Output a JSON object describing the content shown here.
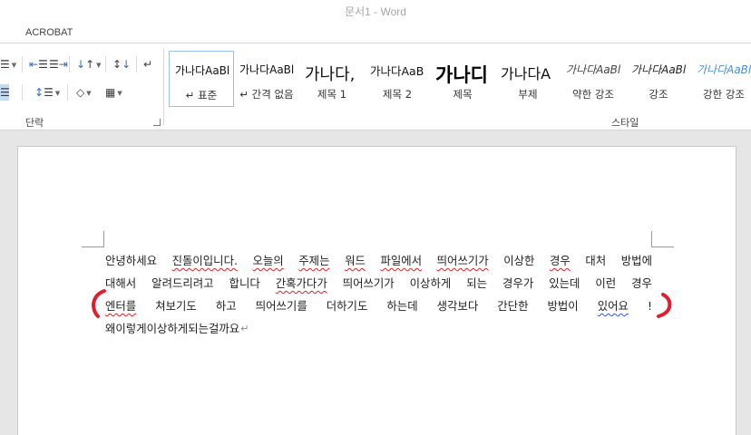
{
  "window": {
    "title": "문서1 - Word"
  },
  "ribbon": {
    "tab": "ACROBAT",
    "paragraph_group_label": "단락",
    "styles_group_label": "스타일",
    "styles": [
      {
        "sample": "가나다AaBl",
        "label": "↵ 표준",
        "size": 12,
        "weight": "normal",
        "italic": false,
        "color": "#111111"
      },
      {
        "sample": "가나다AaBl",
        "label": "↵ 간격 없음",
        "size": 12,
        "weight": "normal",
        "italic": false,
        "color": "#111111"
      },
      {
        "sample": "가나다,",
        "label": "제목 1",
        "size": 18,
        "weight": "normal",
        "italic": false,
        "color": "#111111"
      },
      {
        "sample": "가나다AaB",
        "label": "제목 2",
        "size": 12.5,
        "weight": "normal",
        "italic": false,
        "color": "#111111"
      },
      {
        "sample": "가나디",
        "label": "제목",
        "size": 21,
        "weight": "bold",
        "italic": false,
        "color": "#000000"
      },
      {
        "sample": "가나다A",
        "label": "부제",
        "size": 16,
        "weight": "normal",
        "italic": false,
        "color": "#111111"
      },
      {
        "sample": "가나다AaBl",
        "label": "약한 강조",
        "size": 12,
        "weight": "normal",
        "italic": true,
        "color": "#444444"
      },
      {
        "sample": "가나다AaBl",
        "label": "강조",
        "size": 12,
        "weight": "normal",
        "italic": true,
        "color": "#222222"
      },
      {
        "sample": "가나다AaBl",
        "label": "강한 강조",
        "size": 12,
        "weight": "normal",
        "italic": true,
        "color": "#4a8fd1"
      }
    ]
  },
  "document": {
    "lines": [
      [
        {
          "text": "안녕하세요",
          "sq": ""
        },
        {
          "text": "진돌이입니다.",
          "sq": "red"
        },
        {
          "text": "오늘의",
          "sq": "red"
        },
        {
          "text": "주제는",
          "sq": "red"
        },
        {
          "text": "워드",
          "sq": "red"
        },
        {
          "text": "파일에서",
          "sq": "red"
        },
        {
          "text": "띄어쓰기가",
          "sq": "red"
        },
        {
          "text": "이상한",
          "sq": ""
        },
        {
          "text": "경우",
          "sq": "red"
        },
        {
          "text": "대처",
          "sq": ""
        },
        {
          "text": "방법에",
          "sq": ""
        }
      ],
      [
        {
          "text": "대해서",
          "sq": ""
        },
        {
          "text": "알려드리려고",
          "sq": ""
        },
        {
          "text": "합니다",
          "sq": ""
        },
        {
          "text": "간혹가다가",
          "sq": "red"
        },
        {
          "text": "띄어쓰기가",
          "sq": ""
        },
        {
          "text": "이상하게",
          "sq": ""
        },
        {
          "text": "되는",
          "sq": ""
        },
        {
          "text": "경우가",
          "sq": ""
        },
        {
          "text": "있는데",
          "sq": ""
        },
        {
          "text": "이런",
          "sq": ""
        },
        {
          "text": "경우",
          "sq": ""
        }
      ],
      [
        {
          "text": "엔터를",
          "sq": "red"
        },
        {
          "text": "쳐보기도",
          "sq": ""
        },
        {
          "text": "하고",
          "sq": ""
        },
        {
          "text": "띄어쓰기를",
          "sq": ""
        },
        {
          "text": "더하기도",
          "sq": ""
        },
        {
          "text": "하는데",
          "sq": ""
        },
        {
          "text": "생각보다",
          "sq": ""
        },
        {
          "text": "간단한",
          "sq": ""
        },
        {
          "text": "방법이",
          "sq": ""
        },
        {
          "text": "있어요",
          "sq": "blue"
        },
        {
          "text": "!",
          "sq": ""
        }
      ]
    ],
    "last_line": "왜이렇게이상하게되는걸까요",
    "paragraph_mark": "↵"
  },
  "colors": {
    "annotation_red": "#e01e2e",
    "squiggle_red": "#dd2222",
    "squiggle_blue": "#3355dd"
  }
}
